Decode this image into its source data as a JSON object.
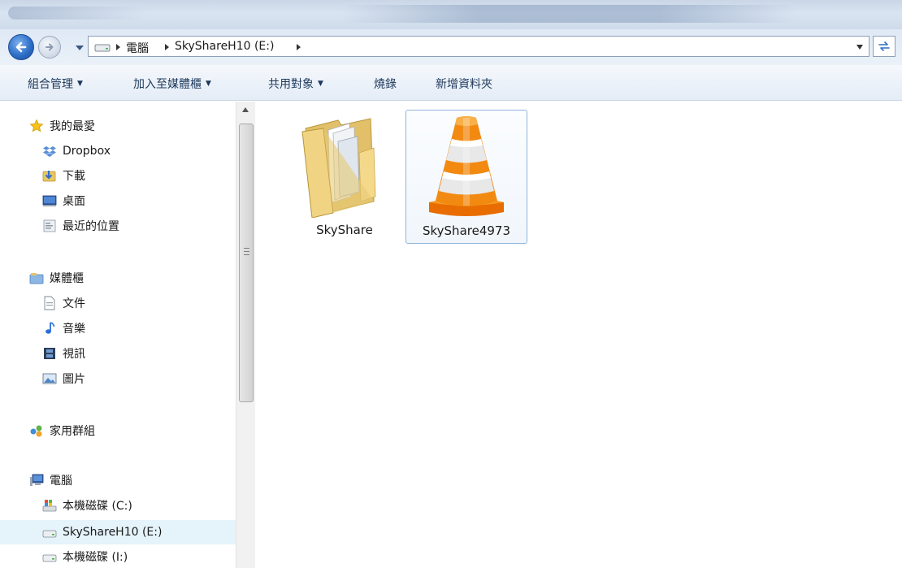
{
  "address": {
    "crumbs": [
      "電腦",
      "SkyShareH10 (E:)"
    ]
  },
  "toolbar": {
    "organize": "組合管理",
    "add_to_library": "加入至媒體櫃",
    "share_with": "共用對象",
    "burn": "燒錄",
    "new_folder": "新增資料夾"
  },
  "navpane": {
    "favorites": {
      "label": "我的最愛",
      "items": [
        "Dropbox",
        "下載",
        "桌面",
        "最近的位置"
      ]
    },
    "libraries": {
      "label": "媒體櫃",
      "items": [
        "文件",
        "音樂",
        "視訊",
        "圖片"
      ]
    },
    "homegroup": {
      "label": "家用群組"
    },
    "computer": {
      "label": "電腦",
      "items": [
        "本機磁碟 (C:)",
        "SkyShareH10 (E:)",
        "本機磁碟 (I:)"
      ],
      "selected": "SkyShareH10 (E:)"
    }
  },
  "files": [
    {
      "name": "SkyShare",
      "type": "folder",
      "icon": "folder-icon"
    },
    {
      "name": "SkyShare4973",
      "type": "vlc-file",
      "icon": "vlc-cone-icon",
      "selected": true
    }
  ],
  "colors": {
    "accent": "#2f6fc8",
    "selection": "#e5f3fb",
    "toolbar_text": "#1e395b"
  }
}
